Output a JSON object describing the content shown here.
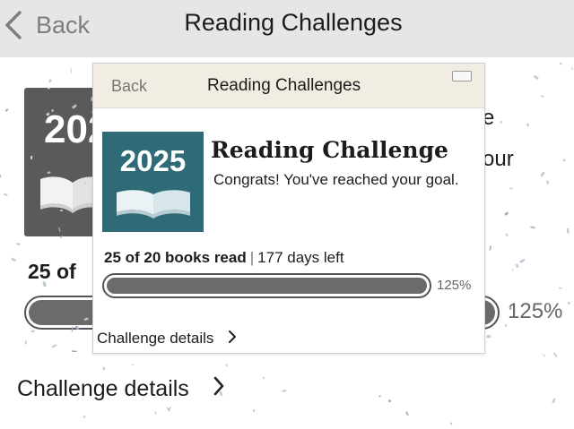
{
  "background": {
    "nav": {
      "back_label": "Back",
      "title": "Reading Challenges"
    },
    "cover": {
      "year": "2025",
      "icon": "open-book-icon"
    },
    "text_fragment_top": "e",
    "text_fragment": "our",
    "stats": "25 of",
    "progress": {
      "fraction": 1.0,
      "percent_label": "125%"
    },
    "details_label": "Challenge details"
  },
  "card": {
    "nav": {
      "back_label": "Back",
      "title": "Reading Challenges"
    },
    "cover": {
      "year": "2025",
      "icon": "open-book-icon"
    },
    "heading": "Reading Challenge",
    "message": "Congrats! You've reached your goal.",
    "stats": {
      "books_read": "25 of 20 books read",
      "separator": "|",
      "days_left": "177 days left"
    },
    "progress": {
      "fraction": 1.0,
      "percent_label": "125%"
    },
    "details_label": "Challenge details"
  },
  "colors": {
    "nav_background": "#e6e6e6",
    "card_nav_background": "#f1ede2",
    "cover_teal": "#2f6b77",
    "cover_gray": "#5a5a5a",
    "progress_fill": "#6b6b6b"
  }
}
